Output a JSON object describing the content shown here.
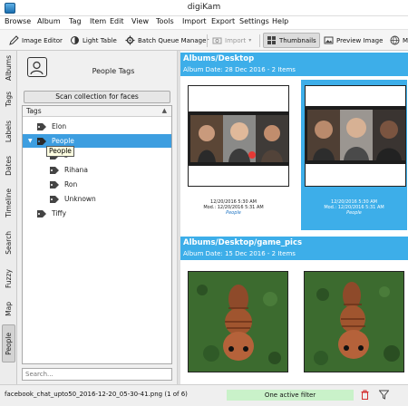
{
  "window": {
    "title": "digiKam"
  },
  "menu": [
    "Browse",
    "Album",
    "Tag",
    "Item",
    "Edit",
    "View",
    "Tools",
    "Import",
    "Export",
    "Settings",
    "Help"
  ],
  "toolbar": {
    "image_editor": "Image Editor",
    "light_table": "Light Table",
    "batch_queue": "Batch Queue Manager",
    "import": "Import",
    "thumbnails": "Thumbnails",
    "preview": "Preview Image",
    "overflow": "M"
  },
  "sidebar_tabs": [
    "Albums",
    "Tags",
    "Labels",
    "Dates",
    "Timeline",
    "Search",
    "Fuzzy",
    "Map",
    "People"
  ],
  "people_panel": {
    "title": "People Tags",
    "scan_button": "Scan collection for faces",
    "tree_header": "Tags",
    "tags": [
      {
        "label": "Elon",
        "level": 0
      },
      {
        "label": "People",
        "level": 0,
        "expanded": true,
        "selected": true
      },
      {
        "label": "s",
        "level": 1
      },
      {
        "label": "Rihana",
        "level": 1
      },
      {
        "label": "Ron",
        "level": 1
      },
      {
        "label": "Unknown",
        "level": 1
      },
      {
        "label": "Tiffy",
        "level": 0
      }
    ],
    "tooltip": "People",
    "search_placeholder": "Search..."
  },
  "groups": [
    {
      "title": "Albums/Desktop",
      "subtitle": "Album Date: 28 Dec 2016 - 2 Items",
      "items": [
        {
          "date": "12/20/2016 5:30 AM",
          "modified": "Mod.: 12/20/2016 5:31 AM",
          "tag": "People",
          "selected": false
        },
        {
          "date": "12/20/2016 5:30 AM",
          "modified": "Mod.: 12/20/2016 5:31 AM",
          "tag": "People",
          "selected": true
        }
      ]
    },
    {
      "title": "Albums/Desktop/game_pics",
      "subtitle": "Album Date: 15 Dec 2016 - 2 Items"
    }
  ],
  "status": {
    "file": "facebook_chat_upto50_2016-12-20_05-30-41.png (1 of 6)",
    "filter": "One active filter"
  },
  "colors": {
    "accent": "#3daee9",
    "selection": "#3d9ee0",
    "filter_bg": "#c9f2c9"
  }
}
